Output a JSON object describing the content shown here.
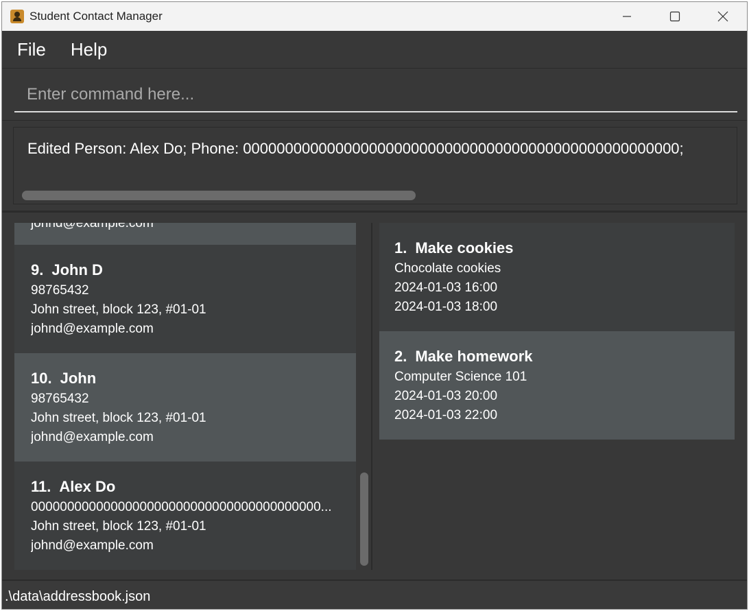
{
  "window": {
    "title": "Student Contact Manager"
  },
  "menu": {
    "file": "File",
    "help": "Help"
  },
  "command": {
    "placeholder": "Enter command here..."
  },
  "result": {
    "text": "Edited Person: Alex Do; Phone: 0000000000000000000000000000000000000000000000000000;"
  },
  "persons": {
    "partial_email": "johnd@example.com",
    "items": [
      {
        "index": "9.",
        "name": "John D",
        "phone": "98765432",
        "address": "John street, block 123, #01-01",
        "email": "johnd@example.com"
      },
      {
        "index": "10.",
        "name": "John",
        "phone": "98765432",
        "address": "John street, block 123, #01-01",
        "email": "johnd@example.com"
      },
      {
        "index": "11.",
        "name": "Alex Do",
        "phone": "0000000000000000000000000000000000000000...",
        "address": "John street, block 123, #01-01",
        "email": "johnd@example.com"
      }
    ]
  },
  "events": {
    "items": [
      {
        "index": "1.",
        "name": "Make cookies",
        "description": "Chocolate cookies",
        "start": "2024-01-03 16:00",
        "end": "2024-01-03 18:00"
      },
      {
        "index": "2.",
        "name": "Make homework",
        "description": "Computer Science 101",
        "start": "2024-01-03 20:00",
        "end": "2024-01-03 22:00"
      }
    ]
  },
  "status": {
    "path": ".\\data\\addressbook.json"
  }
}
